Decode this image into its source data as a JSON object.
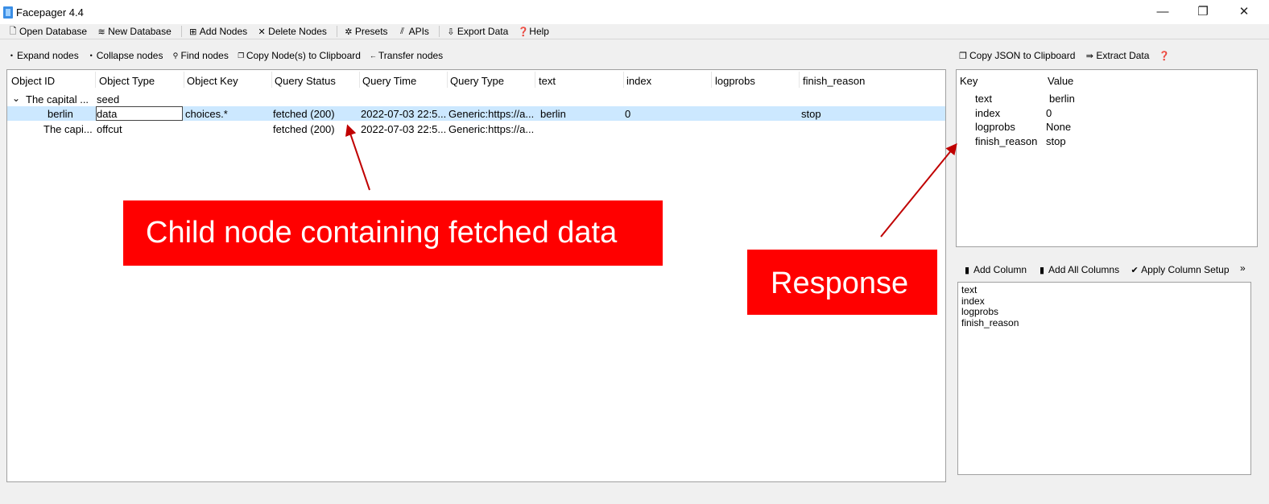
{
  "window": {
    "title": "Facepager 4.4",
    "controls": [
      "—",
      "❐",
      "✕"
    ]
  },
  "menu": [
    {
      "label": "Open Database",
      "icon": "open-database-icon"
    },
    {
      "label": "New Database",
      "icon": "new-database-icon"
    },
    {
      "label": "Add Nodes",
      "icon": "add-nodes-icon"
    },
    {
      "label": "Delete Nodes",
      "icon": "delete-nodes-icon"
    },
    {
      "label": "Presets",
      "icon": "presets-icon"
    },
    {
      "label": "APIs",
      "icon": "apis-icon"
    },
    {
      "label": "Export Data",
      "icon": "export-data-icon"
    },
    {
      "label": "Help",
      "icon": "help-icon"
    }
  ],
  "node_toolbar": [
    {
      "label": "Expand nodes",
      "icon": "expand-icon"
    },
    {
      "label": "Collapse nodes",
      "icon": "collapse-icon"
    },
    {
      "label": "Find nodes",
      "icon": "search-icon"
    },
    {
      "label": "Copy Node(s) to Clipboard",
      "icon": "copy-icon"
    },
    {
      "label": "Transfer nodes",
      "icon": "transfer-icon"
    }
  ],
  "tree": {
    "columns": [
      "Object ID",
      "Object Type",
      "Object Key",
      "Query Status",
      "Query Time",
      "Query Type",
      "text",
      "index",
      "logprobs",
      "finish_reason"
    ],
    "rows": [
      {
        "object_id": "The capital ...",
        "object_type": "seed",
        "object_key": "",
        "query_status": "",
        "query_time": "",
        "query_type": "",
        "text": "",
        "index": "",
        "logprobs": "",
        "finish_reason": ""
      },
      {
        "object_id": "berlin",
        "object_type": "data",
        "object_key": "choices.*",
        "query_status": "fetched (200)",
        "query_time": "2022-07-03 22:5...",
        "query_type": "Generic:https://a...",
        "text": "berlin",
        "index": "0",
        "logprobs": "",
        "finish_reason": "stop"
      },
      {
        "object_id": "The capi...",
        "object_type": "offcut",
        "object_key": "",
        "query_status": "fetched (200)",
        "query_time": "2022-07-03 22:5...",
        "query_type": "Generic:https://a...",
        "text": "",
        "index": "",
        "logprobs": "",
        "finish_reason": ""
      }
    ]
  },
  "annotations": {
    "child_node": "Child node containing fetched data",
    "response": "Response"
  },
  "detail_toolbar": [
    {
      "label": "Copy JSON to Clipboard",
      "icon": "copy-icon"
    },
    {
      "label": "Extract Data",
      "icon": "extract-icon"
    },
    {
      "label": "",
      "icon": "help-icon"
    }
  ],
  "detail": {
    "headers": [
      "Key",
      "Value"
    ],
    "rows": [
      {
        "key": "text",
        "value": "berlin"
      },
      {
        "key": "index",
        "value": "0"
      },
      {
        "key": "logprobs",
        "value": "None"
      },
      {
        "key": "finish_reason",
        "value": "stop"
      }
    ]
  },
  "column_toolbar": [
    {
      "label": "Add Column",
      "icon": "add-column-icon"
    },
    {
      "label": "Add All Columns",
      "icon": "add-all-columns-icon"
    },
    {
      "label": "Apply Column Setup",
      "icon": "check-circle-icon"
    }
  ],
  "column_more": "»",
  "column_setup_lines": [
    "text",
    "index",
    "logprobs",
    "finish_reason"
  ],
  "colors": {
    "accent_red": "#ff0000",
    "selection": "#cce8ff",
    "app_icon": "#3a8ee6"
  }
}
